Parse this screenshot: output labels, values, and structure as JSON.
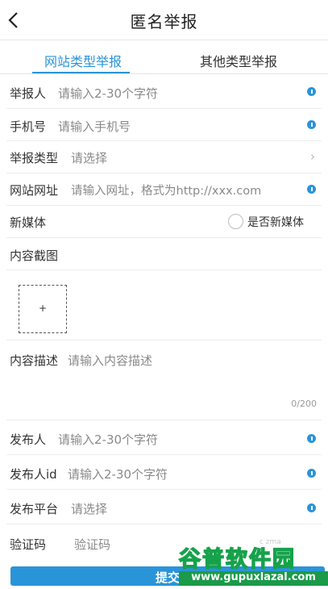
{
  "header": {
    "title": "匿名举报"
  },
  "tabs": [
    {
      "label": "网站类型举报"
    },
    {
      "label": "其他类型举报"
    }
  ],
  "form": {
    "reporter": {
      "label": "举报人",
      "placeholder": "请输入2-30个字符"
    },
    "phone": {
      "label": "手机号",
      "placeholder": "请输入手机号"
    },
    "report_type": {
      "label": "举报类型",
      "placeholder": "请选择"
    },
    "website": {
      "label": "网站网址",
      "placeholder": "请输入网址，格式为http://xxx.com"
    },
    "new_media": {
      "label": "新媒体",
      "option": "是否新媒体"
    },
    "screenshot": {
      "label": "内容截图",
      "upload": "+"
    },
    "description": {
      "label": "内容描述",
      "placeholder": "请输入内容描述",
      "counter": "0/200"
    },
    "publisher": {
      "label": "发布人",
      "placeholder": "请输入2-30个字符"
    },
    "publisher_id": {
      "label": "发布人id",
      "placeholder": "请输入2-30个字符"
    },
    "platform": {
      "label": "发布平台",
      "placeholder": "请选择"
    },
    "captcha": {
      "label": "验证码",
      "placeholder": "验证码"
    }
  },
  "submit": {
    "label": "提交"
  },
  "watermark": {
    "brand": "谷普软件园",
    "url": "www.gupuxlazal.com",
    "captcha_chars": "c zma"
  },
  "colors": {
    "accent": "#2a94d8",
    "watermark_green": "#16a24a"
  }
}
